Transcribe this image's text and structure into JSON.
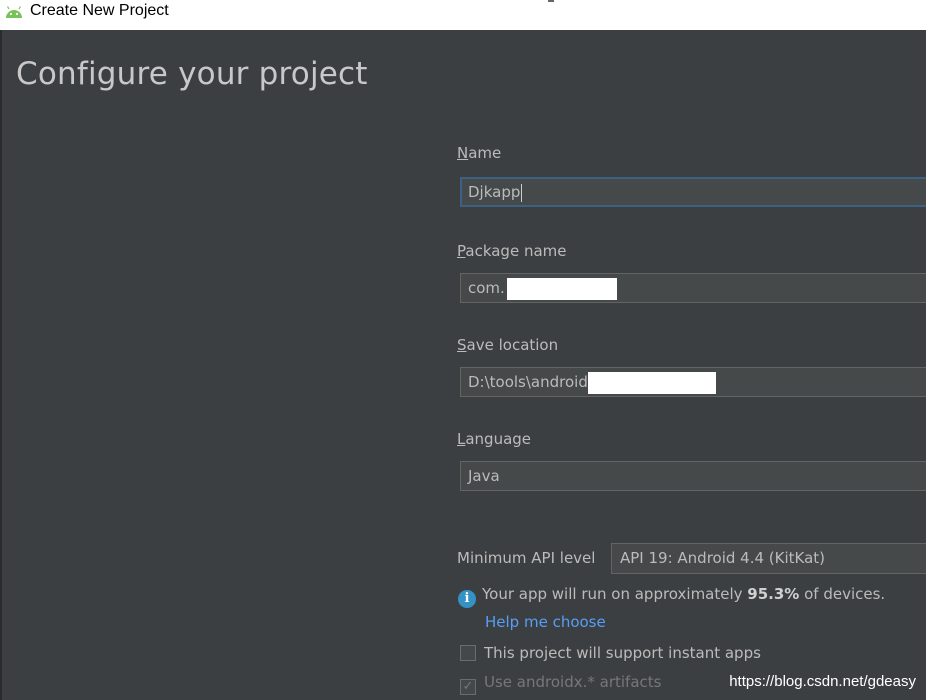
{
  "window": {
    "title": "Create New Project",
    "logo_icon": "android-icon"
  },
  "page": {
    "heading": "Configure your project"
  },
  "name_field": {
    "label_mnemonic": "N",
    "label_rest": "ame",
    "value": "Djkapp"
  },
  "package_field": {
    "label_mnemonic": "P",
    "label_rest": "ackage name",
    "value": "com."
  },
  "location_field": {
    "label_mnemonic": "S",
    "label_rest": "ave location",
    "value": "D:\\tools\\android"
  },
  "language_field": {
    "label_mnemonic": "L",
    "label_rest": "anguage",
    "value": "Java"
  },
  "min_api": {
    "label": "Minimum API level",
    "value": "API 19: Android 4.4 (KitKat)"
  },
  "info": {
    "prefix": "Your app will run on approximately ",
    "percent": "95.3%",
    "suffix": " of devices.",
    "help_link": "Help me choose"
  },
  "checkboxes": [
    {
      "label": "This project will support instant apps",
      "checked": false,
      "enabled": true
    },
    {
      "label": "Use androidx.* artifacts",
      "checked": true,
      "enabled": false
    }
  ],
  "watermark": "https://blog.csdn.net/gdeasy",
  "colors": {
    "background": "#3c3f41",
    "link": "#589df6",
    "focus_border": "#3d6185",
    "info_icon": "#3592c4"
  }
}
